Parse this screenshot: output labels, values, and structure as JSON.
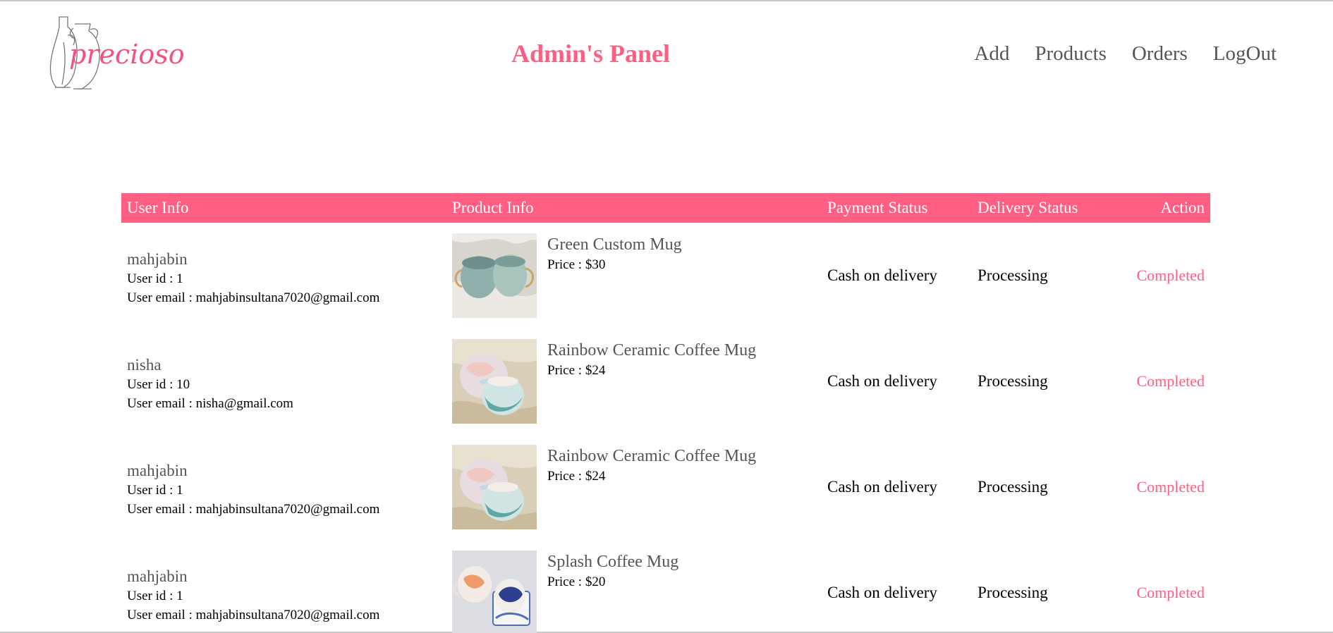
{
  "brand": {
    "logo_text": "precioso"
  },
  "header": {
    "title": "Admin's Panel",
    "nav": [
      {
        "label": "Add"
      },
      {
        "label": "Products"
      },
      {
        "label": "Orders"
      },
      {
        "label": "LogOut"
      }
    ]
  },
  "table": {
    "headers": {
      "user": "User Info",
      "product": "Product Info",
      "payment": "Payment Status",
      "delivery": "Delivery Status",
      "action": "Action"
    },
    "rows": [
      {
        "user_name": "mahjabin",
        "user_id": "User id : 1",
        "user_email": "User email : mahjabinsultana7020@gmail.com",
        "product_name": "Green Custom Mug",
        "product_price": "Price : $30",
        "product_image": "green-mugs-image",
        "payment": "Cash on delivery",
        "delivery": "Processing",
        "action": "Completed"
      },
      {
        "user_name": "nisha",
        "user_id": "User id : 10",
        "user_email": "User email : nisha@gmail.com",
        "product_name": "Rainbow Ceramic Coffee Mug",
        "product_price": "Price : $24",
        "product_image": "rainbow-mugs-image",
        "payment": "Cash on delivery",
        "delivery": "Processing",
        "action": "Completed"
      },
      {
        "user_name": "mahjabin",
        "user_id": "User id : 1",
        "user_email": "User email : mahjabinsultana7020@gmail.com",
        "product_name": "Rainbow Ceramic Coffee Mug",
        "product_price": "Price : $24",
        "product_image": "rainbow-mugs-image",
        "payment": "Cash on delivery",
        "delivery": "Processing",
        "action": "Completed"
      },
      {
        "user_name": "mahjabin",
        "user_id": "User id : 1",
        "user_email": "User email : mahjabinsultana7020@gmail.com",
        "product_name": "Splash Coffee Mug",
        "product_price": "Price : $20",
        "product_image": "splash-mugs-image",
        "payment": "Cash on delivery",
        "delivery": "Processing",
        "action": "Completed"
      }
    ]
  },
  "colors": {
    "accent": "#fe5f83",
    "nav_text": "#555555"
  }
}
